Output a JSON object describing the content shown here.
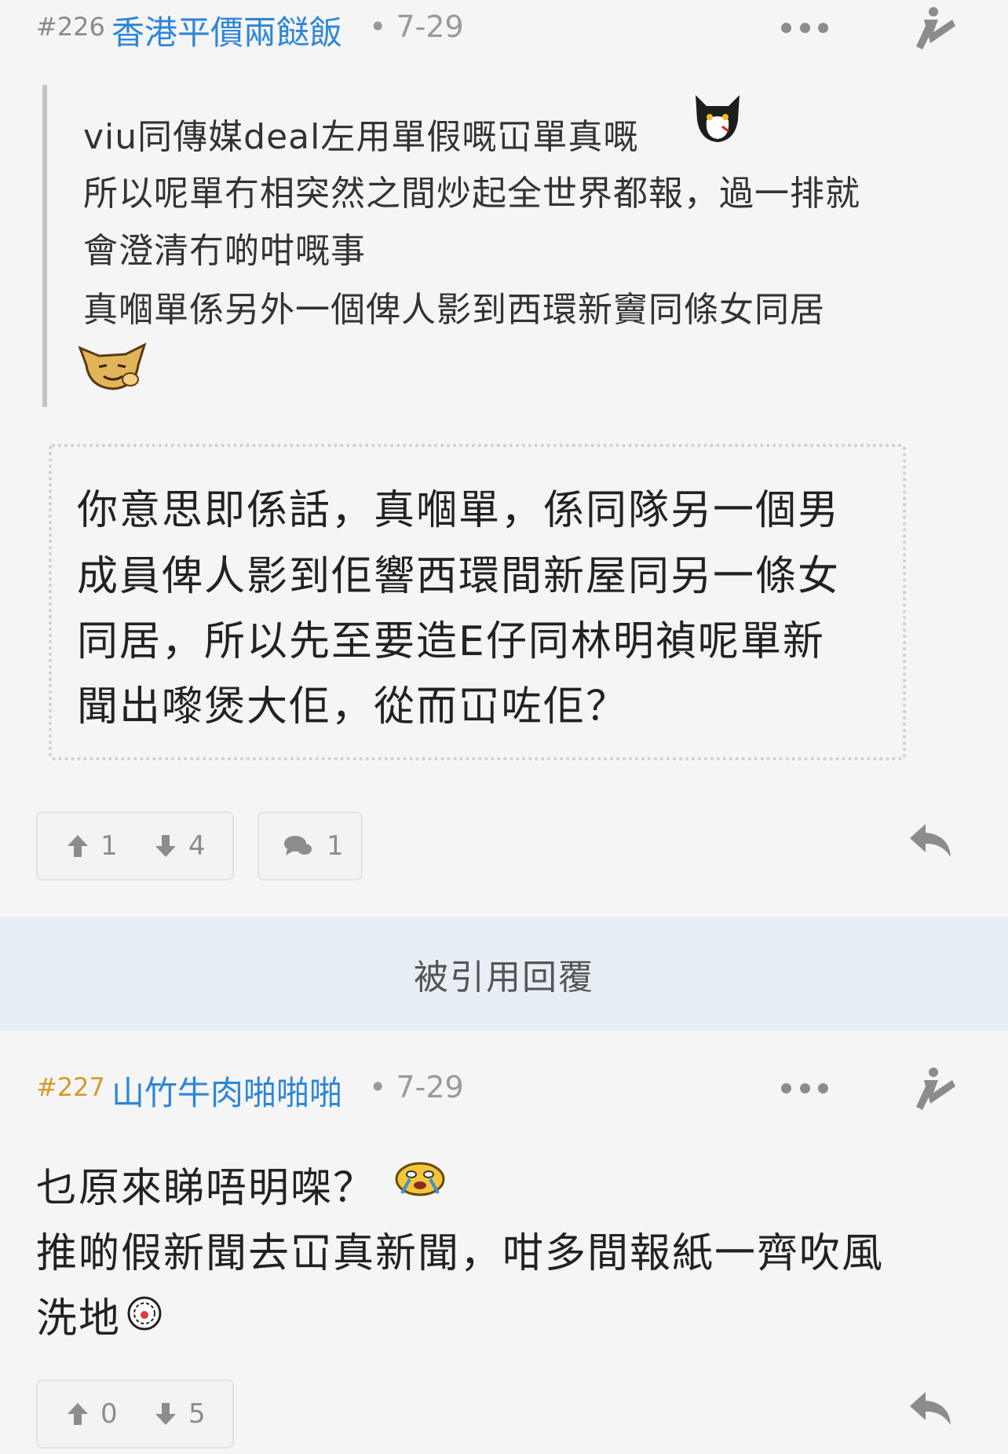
{
  "post_226": {
    "floor": "#226",
    "username": "香港平價兩餸飯",
    "date": "• 7-29",
    "quote_lines": [
      "viu同傳媒deal左用單假嘅冚單真嘅",
      "所以呢單冇相突然之間炒起全世界都報，過一排就",
      "會澄清冇啲咁嘅事",
      "真嗰單係另外一個俾人影到西環新竇同條女同居"
    ],
    "body_lines": [
      "你意思即係話，真嗰單，係同隊另一個男",
      "成員俾人影到佢響西環間新屋同另一條女",
      "同居，所以先至要造E仔同林明禎呢單新",
      "聞出嚟煲大佢，從而冚咗佢？"
    ],
    "upvotes": "1",
    "downvotes": "4",
    "replies": "1"
  },
  "banner": {
    "label": "被引用回覆"
  },
  "post_227": {
    "floor": "#227",
    "username": "山竹牛肉啪啪啪",
    "date": "• 7-29",
    "body_lines": [
      "乜原來睇唔明㗎？",
      "推啲假新聞去冚真新聞，咁多間報紙一齊吹風",
      "洗地"
    ],
    "upvotes": "0",
    "downvotes": "5"
  },
  "icons": [
    "more-icon",
    "quote-icon",
    "upvote-icon",
    "downvote-icon",
    "comment-icon",
    "reply-icon",
    "cat-emoji",
    "dog-emoji",
    "crying-emoji",
    "dizzy-emoji"
  ]
}
